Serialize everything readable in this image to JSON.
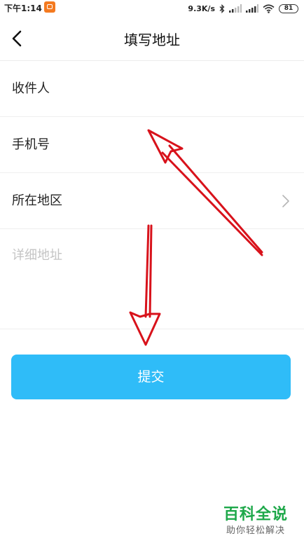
{
  "status_bar": {
    "time": "下午1:14",
    "net_speed": "9.3K/s",
    "battery": "81"
  },
  "nav": {
    "title": "填写地址"
  },
  "form": {
    "recipient_label": "收件人",
    "phone_label": "手机号",
    "region_label": "所在地区",
    "detail_placeholder": "详细地址"
  },
  "submit": {
    "label": "提交"
  },
  "watermark": {
    "title": "百科全说",
    "subtitle": "助你轻松解决"
  },
  "colors": {
    "submit_button": "#2fbcf8",
    "annotation_arrow": "#d8121b",
    "watermark_green": "#1ea84a"
  }
}
